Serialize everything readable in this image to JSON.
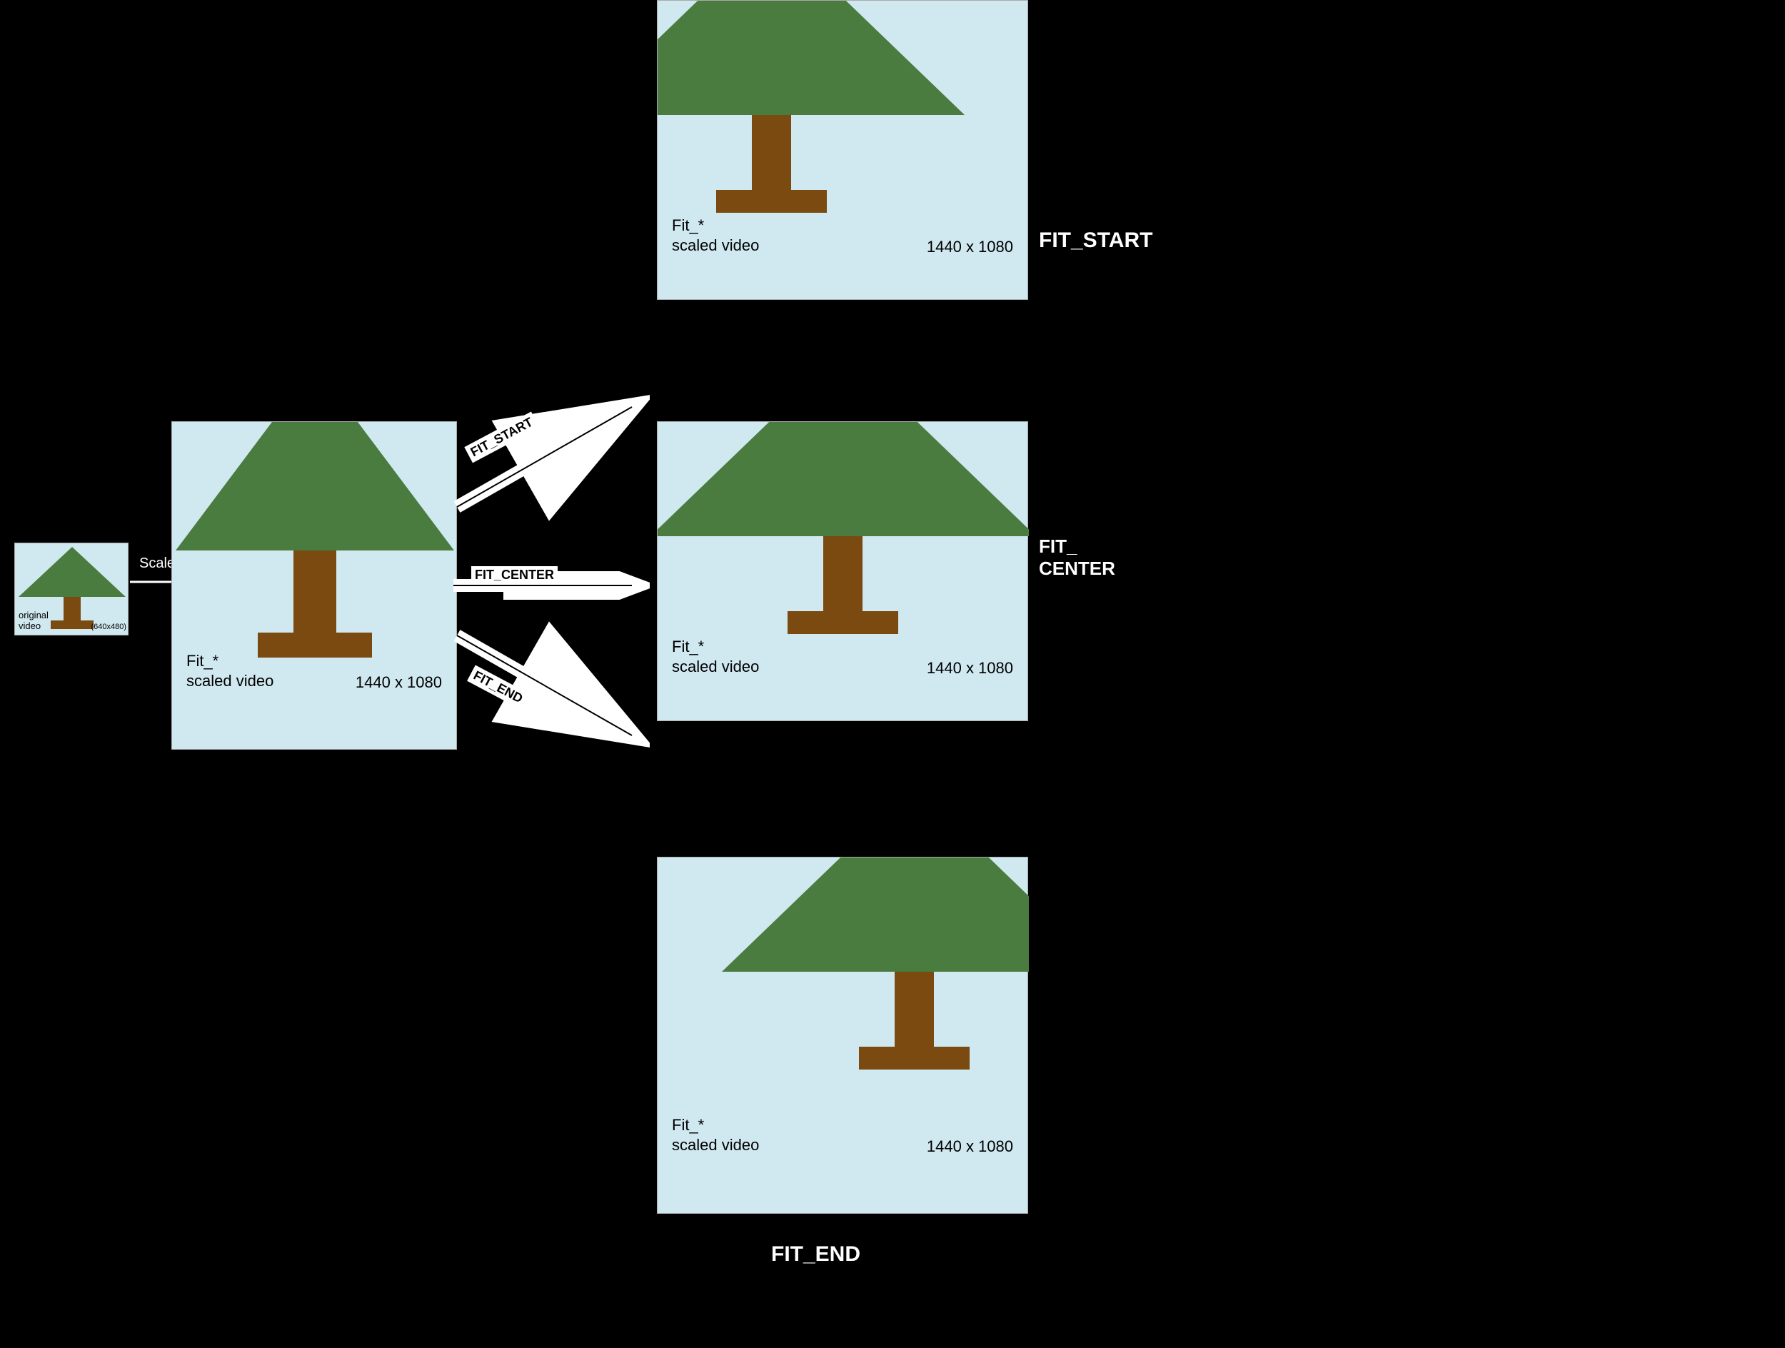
{
  "original": {
    "label1": "original",
    "label2": "video",
    "size": "(640x480)"
  },
  "scale_label": "Scale",
  "fit_scaled_label": "Fit_*\nscaled video",
  "dimensions": "1440 x 1080",
  "fit_start": "FIT_START",
  "fit_center": "FIT_\nCENTER",
  "fit_end": "FIT_END",
  "fit_start_arrow": "FIT_START",
  "fit_center_arrow": "FIT_CENTER",
  "fit_end_arrow": "FIT_END"
}
